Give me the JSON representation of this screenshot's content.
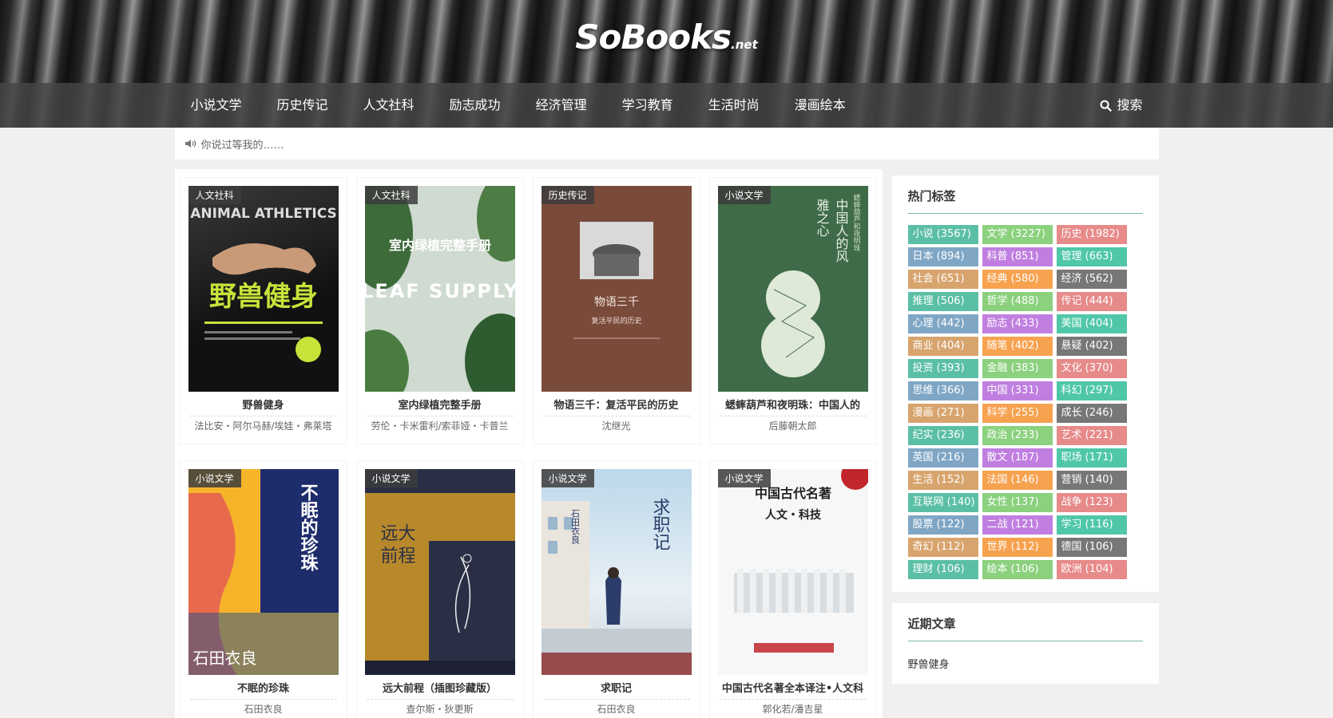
{
  "site": {
    "brand": "SoBooks",
    "tld": ".net"
  },
  "nav": {
    "items": [
      "小说文学",
      "历史传记",
      "人文社科",
      "励志成功",
      "经济管理",
      "学习教育",
      "生活时尚",
      "漫画绘本"
    ],
    "search_label": "搜索",
    "search_icon": "search-icon"
  },
  "notice": {
    "text": "你说过等我的……",
    "icon": "speaker-icon"
  },
  "books": [
    {
      "category": "人文社科",
      "title": "野兽健身",
      "author": "法比安・阿尔马赫/埃娃・弗莱塔",
      "cover_text": "野兽健身",
      "cover_sub": "ANIMAL ATHLETICS"
    },
    {
      "category": "人文社科",
      "title": "室内绿植完整手册",
      "author": "劳伦・卡米雷利/索菲娅・卡普兰",
      "cover_text": "室内绿植完整手册",
      "cover_sub": "LEAF SUPPLY"
    },
    {
      "category": "历史传记",
      "title": "物语三千：复活平民的历史",
      "author": "沈继光",
      "cover_text": "物语三千",
      "cover_sub": "复活平民的历史"
    },
    {
      "category": "小说文学",
      "title": "蟋蟀葫芦和夜明珠：中国人的",
      "author": "后藤朝太郎",
      "cover_text": "中国人的风雅之心",
      "cover_sub": "蟋蟀葫芦和夜明珠"
    },
    {
      "category": "小说文学",
      "title": "不眠的珍珠",
      "author": "石田衣良",
      "cover_text": "不眠的珍珠",
      "cover_sub": "石田衣良"
    },
    {
      "category": "小说文学",
      "title": "远大前程（插图珍藏版）",
      "author": "查尔斯・狄更斯",
      "cover_text": "远大前程",
      "cover_sub": ""
    },
    {
      "category": "小说文学",
      "title": "求职记",
      "author": "石田衣良",
      "cover_text": "求职记",
      "cover_sub": "石田衣良"
    },
    {
      "category": "小说文学",
      "title": "中国古代名著全本译注•人文科",
      "author": "郭化若/潘吉星",
      "cover_text": "中国古代名著",
      "cover_sub": "人文・科技"
    }
  ],
  "hot_tags": {
    "title": "热门标签",
    "items": [
      {
        "label": "小说 (3567)",
        "color": "#5bbfa6"
      },
      {
        "label": "文学 (3227)",
        "color": "#8bd17e"
      },
      {
        "label": "历史 (1982)",
        "color": "#e78a8a"
      },
      {
        "label": "日本 (894)",
        "color": "#7fa6c5"
      },
      {
        "label": "科普 (851)",
        "color": "#c07fe0"
      },
      {
        "label": "管理 (663)",
        "color": "#4fc7a8"
      },
      {
        "label": "社会 (651)",
        "color": "#d8a46d"
      },
      {
        "label": "经典 (580)",
        "color": "#f7a24f"
      },
      {
        "label": "经济 (562)",
        "color": "#777777"
      },
      {
        "label": "推理 (506)",
        "color": "#5bbfa6"
      },
      {
        "label": "哲学 (488)",
        "color": "#8bd17e"
      },
      {
        "label": "传记 (444)",
        "color": "#e78a8a"
      },
      {
        "label": "心理 (442)",
        "color": "#7fa6c5"
      },
      {
        "label": "励志 (433)",
        "color": "#c07fe0"
      },
      {
        "label": "美国 (404)",
        "color": "#4fc7a8"
      },
      {
        "label": "商业 (404)",
        "color": "#d8a46d"
      },
      {
        "label": "随笔 (402)",
        "color": "#f7a24f"
      },
      {
        "label": "悬疑 (402)",
        "color": "#777777"
      },
      {
        "label": "投资 (393)",
        "color": "#5bbfa6"
      },
      {
        "label": "金融 (383)",
        "color": "#8bd17e"
      },
      {
        "label": "文化 (370)",
        "color": "#e78a8a"
      },
      {
        "label": "思维 (366)",
        "color": "#7fa6c5"
      },
      {
        "label": "中国 (331)",
        "color": "#c07fe0"
      },
      {
        "label": "科幻 (297)",
        "color": "#4fc7a8"
      },
      {
        "label": "漫画 (271)",
        "color": "#d8a46d"
      },
      {
        "label": "科学 (255)",
        "color": "#f7a24f"
      },
      {
        "label": "成长 (246)",
        "color": "#777777"
      },
      {
        "label": "纪实 (236)",
        "color": "#5bbfa6"
      },
      {
        "label": "政治 (233)",
        "color": "#8bd17e"
      },
      {
        "label": "艺术 (221)",
        "color": "#e78a8a"
      },
      {
        "label": "英国 (216)",
        "color": "#7fa6c5"
      },
      {
        "label": "散文 (187)",
        "color": "#c07fe0"
      },
      {
        "label": "职场 (171)",
        "color": "#4fc7a8"
      },
      {
        "label": "生活 (152)",
        "color": "#d8a46d"
      },
      {
        "label": "法国 (146)",
        "color": "#f7a24f"
      },
      {
        "label": "营销 (140)",
        "color": "#777777"
      },
      {
        "label": "互联网 (140)",
        "color": "#5bbfa6"
      },
      {
        "label": "女性 (137)",
        "color": "#8bd17e"
      },
      {
        "label": "战争 (123)",
        "color": "#e78a8a"
      },
      {
        "label": "股票 (122)",
        "color": "#7fa6c5"
      },
      {
        "label": "二战 (121)",
        "color": "#c07fe0"
      },
      {
        "label": "学习 (116)",
        "color": "#4fc7a8"
      },
      {
        "label": "奇幻 (112)",
        "color": "#d8a46d"
      },
      {
        "label": "世界 (112)",
        "color": "#f7a24f"
      },
      {
        "label": "德国 (106)",
        "color": "#777777"
      },
      {
        "label": "理财 (106)",
        "color": "#5bbfa6"
      },
      {
        "label": "绘本 (106)",
        "color": "#8bd17e"
      },
      {
        "label": "欧洲 (104)",
        "color": "#e78a8a"
      }
    ]
  },
  "recent": {
    "title": "近期文章",
    "items": [
      "野兽健身"
    ]
  }
}
